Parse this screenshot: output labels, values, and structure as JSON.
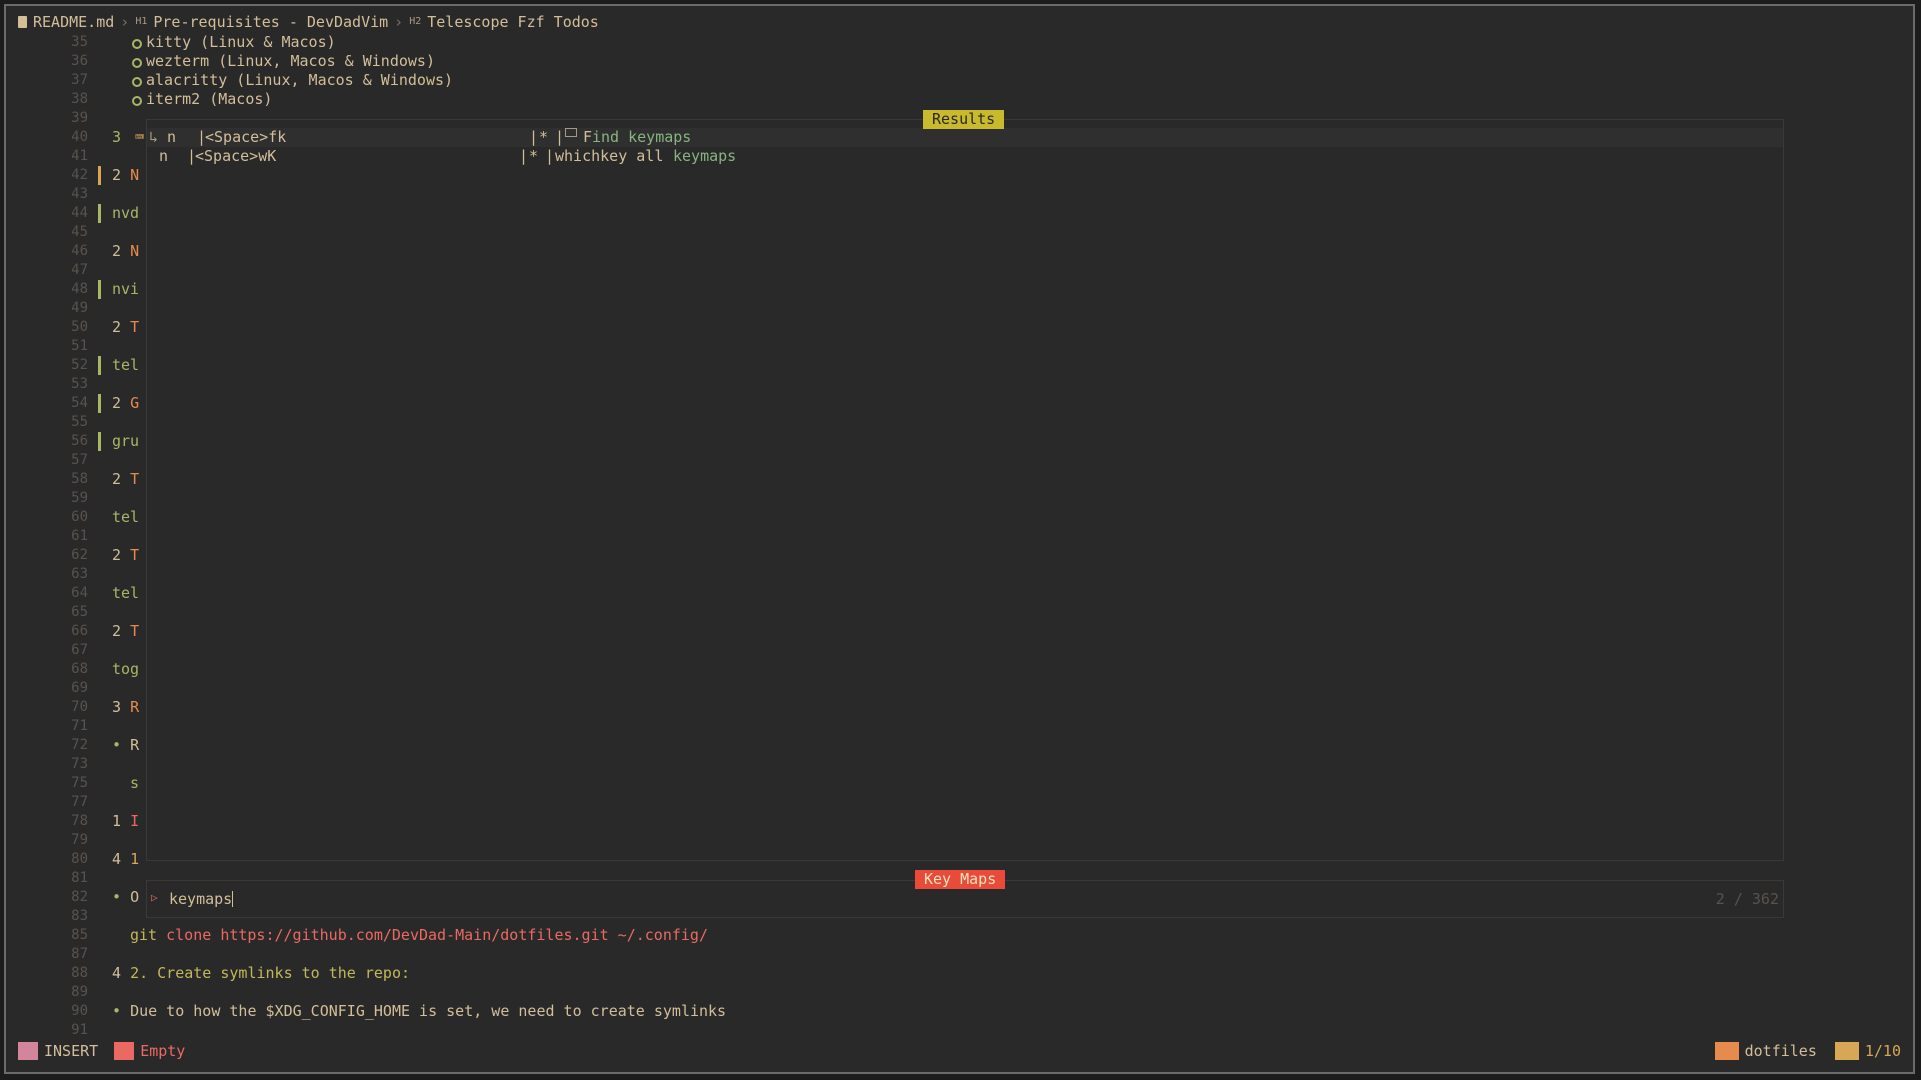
{
  "winbar": {
    "file": "README.md",
    "h1_tag": "H1",
    "h1": "Pre-requisites - DevDadVim",
    "h2_tag": "H2",
    "h2": "Telescope Fzf Todos"
  },
  "editor": {
    "lines": [
      {
        "n": "35",
        "text": "kitty (Linux & Macos)",
        "circle": true
      },
      {
        "n": "36",
        "text": "wezterm (Linux, Macos & Windows)",
        "circle": true
      },
      {
        "n": "37",
        "text": "alacritty (Linux, Macos & Windows)",
        "circle": true
      },
      {
        "n": "38",
        "text": "iterm2 (Macos)",
        "circle": true
      },
      {
        "n": "39",
        "text": ""
      },
      {
        "n": "40",
        "text": "3"
      },
      {
        "n": "41",
        "text": ""
      },
      {
        "n": "42",
        "text": "2 N"
      },
      {
        "n": "43",
        "text": ""
      },
      {
        "n": "44",
        "text": "nvd"
      },
      {
        "n": "45",
        "text": ""
      },
      {
        "n": "46",
        "text": "2 N"
      },
      {
        "n": "47",
        "text": ""
      },
      {
        "n": "48",
        "text": "nvi"
      },
      {
        "n": "49",
        "text": ""
      },
      {
        "n": "50",
        "text": "2 T"
      },
      {
        "n": "51",
        "text": ""
      },
      {
        "n": "52",
        "text": "tel"
      },
      {
        "n": "53",
        "text": ""
      },
      {
        "n": "54",
        "text": "2 G"
      },
      {
        "n": "55",
        "text": ""
      },
      {
        "n": "56",
        "text": "gru"
      },
      {
        "n": "57",
        "text": ""
      },
      {
        "n": "58",
        "text": "2 T"
      },
      {
        "n": "59",
        "text": ""
      },
      {
        "n": "60",
        "text": "tel"
      },
      {
        "n": "61",
        "text": ""
      },
      {
        "n": "62",
        "text": "2 T"
      },
      {
        "n": "63",
        "text": ""
      },
      {
        "n": "64",
        "text": "tel"
      },
      {
        "n": "65",
        "text": ""
      },
      {
        "n": "66",
        "text": "2 T"
      },
      {
        "n": "67",
        "text": ""
      },
      {
        "n": "68",
        "text": "tog"
      },
      {
        "n": "69",
        "text": ""
      },
      {
        "n": "70",
        "text": "3 R"
      },
      {
        "n": "71",
        "text": ""
      },
      {
        "n": "72",
        "text": "• R"
      },
      {
        "n": "73",
        "text": ""
      },
      {
        "n": "75",
        "text": "  s"
      },
      {
        "n": "77",
        "text": ""
      },
      {
        "n": "78",
        "text": "1 I"
      },
      {
        "n": "79",
        "text": ""
      },
      {
        "n": "80",
        "text": "4 1"
      },
      {
        "n": "81",
        "text": ""
      },
      {
        "n": "82",
        "text": "• O"
      },
      {
        "n": "83",
        "text": ""
      },
      {
        "n": "85",
        "text": "git clone https://github.com/DevDad-Main/dotfiles.git ~/.config/"
      },
      {
        "n": "87",
        "text": ""
      },
      {
        "n": "88",
        "text": "4 2. Create symlinks to the repo:"
      },
      {
        "n": "89",
        "text": ""
      },
      {
        "n": "90",
        "text": "• Due to how the $XDG_CONFIG_HOME is set, we need to create symlinks"
      },
      {
        "n": "91",
        "text": ""
      }
    ],
    "line85": {
      "cmd": "git clone ",
      "url": "https://github.com/DevDad-Main/dotfiles.git ~/.config/"
    },
    "line88": {
      "marker": "4 ",
      "text": "2. Create symlinks to the repo:"
    },
    "line90": {
      "marker": "• ",
      "text": "Due to how the $XDG_CONFIG_HOME is set, we need to create symlinks"
    }
  },
  "telescope": {
    "results_title": "Results",
    "prompt_title": "Key Maps",
    "query": "keymaps",
    "count": "2 / 362",
    "results": [
      {
        "mode": "n",
        "lhs": "<Space>fk",
        "flag": "*",
        "desc_pre": "F",
        "desc_hl": "ind keymaps"
      },
      {
        "mode": "n",
        "lhs": "<Space>wK",
        "flag": "*",
        "desc_pre": "whichkey all ",
        "desc_hl": "keymaps"
      }
    ]
  },
  "status": {
    "mode": "INSERT",
    "buffer": "Empty",
    "project": "dotfiles",
    "position": "1/10"
  },
  "colors": {
    "accent_yellow": "#c9b92c",
    "accent_red": "#ea4a3a",
    "bg": "#292929",
    "fg": "#d4be98"
  }
}
